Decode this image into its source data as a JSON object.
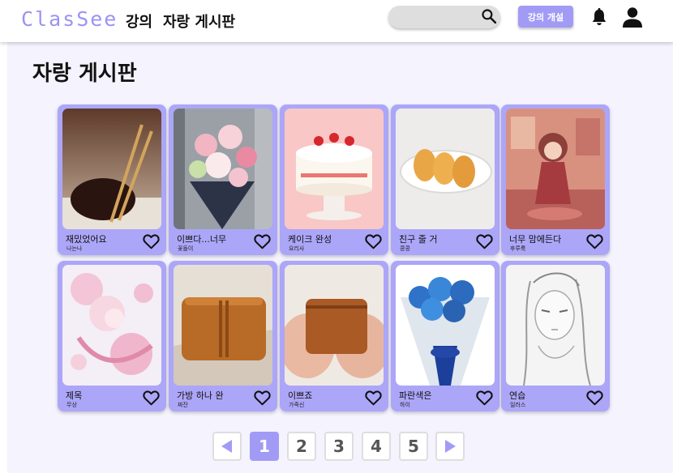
{
  "header": {
    "logo": "ClasSee",
    "nav": [
      "강의",
      "자랑 게시판"
    ],
    "search_placeholder": "",
    "open_course_label": "강의 개설",
    "icons": [
      "search-icon",
      "bell-icon",
      "user-icon"
    ]
  },
  "page": {
    "title": "자랑 게시판"
  },
  "posts": [
    {
      "title": "재밌었어요",
      "author": "나는나"
    },
    {
      "title": "이쁘다...너무",
      "author": "꽃돌이"
    },
    {
      "title": "케이크 완성",
      "author": "요리사"
    },
    {
      "title": "친구 줄 거",
      "author": "콩콩"
    },
    {
      "title": "너무 맘에든다",
      "author": "후루룩"
    },
    {
      "title": "제목",
      "author": "무상"
    },
    {
      "title": "가방 하나 완",
      "author": "짜잔"
    },
    {
      "title": "이쁘죠",
      "author": "가죽신"
    },
    {
      "title": "파란색은",
      "author": "하이"
    },
    {
      "title": "연습",
      "author": "일러스"
    }
  ],
  "pagination": {
    "pages": [
      "1",
      "2",
      "3",
      "4",
      "5"
    ],
    "current": "1"
  },
  "colors": {
    "accent": "#a29bf6",
    "card": "#aca6f8",
    "background": "#f4f3fe"
  }
}
